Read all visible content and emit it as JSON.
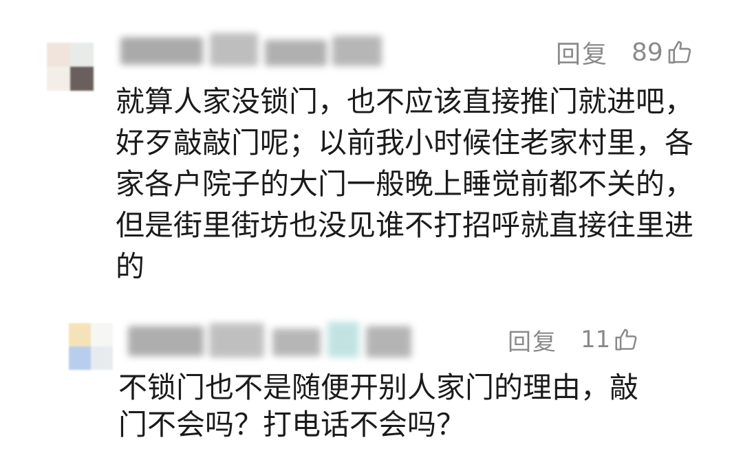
{
  "comments": [
    {
      "reply_label": "回复",
      "likes": "89",
      "text": "就算人家没锁门，也不应该直接推门就进吧，\n好歹敲敲门呢；以前我小时候住老家村里，各\n家各户院子的大门一般晚上睡觉前都不关的，\n但是街里街坊也没见谁不打招呼就直接往里进\n的",
      "avatar_colors": [
        "#f1e4dc",
        "#e8ece8",
        "#f3efe8",
        "#6b5f5d"
      ]
    },
    {
      "reply_label": "回复",
      "likes": "11",
      "text": "不锁门也不是随便开别人家门的理由，敲\n门不会吗？打电话不会吗？",
      "avatar_colors": [
        "#f5e2b8",
        "#f6f6f4",
        "#b9cdef",
        "#e8ebee"
      ]
    }
  ],
  "icons": {
    "like": "thumbs-up-icon"
  },
  "colors": {
    "meta_gray": "#8a8a8a",
    "text": "#1b1b1b",
    "background": "#ffffff"
  }
}
